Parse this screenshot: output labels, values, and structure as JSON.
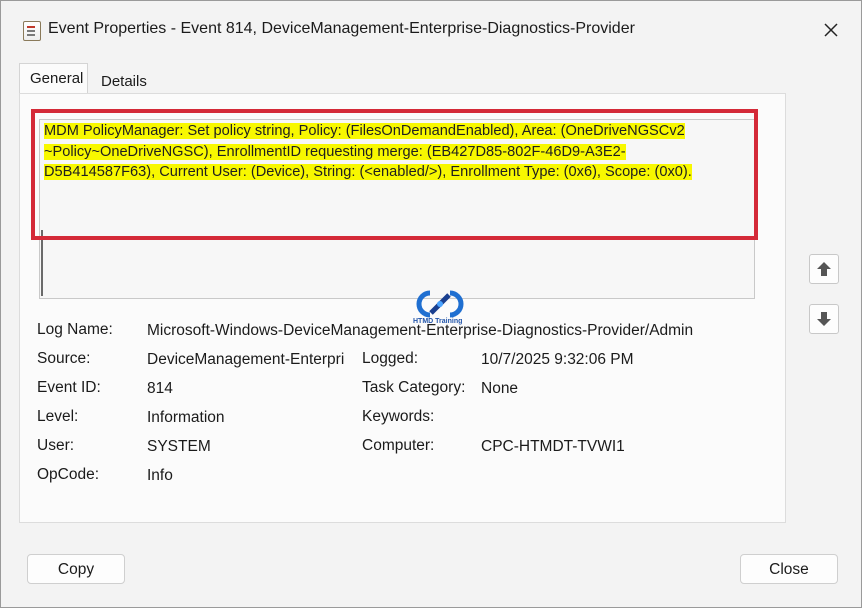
{
  "window": {
    "title": "Event Properties - Event 814, DeviceManagement-Enterprise-Diagnostics-Provider"
  },
  "tabs": [
    {
      "label": "General",
      "selected": true
    },
    {
      "label": "Details",
      "selected": false
    }
  ],
  "description": {
    "line1": "MDM PolicyManager: Set policy string, Policy: (FilesOnDemandEnabled), Area: (OneDriveNGSCv2",
    "line2": "~Policy~OneDriveNGSC), EnrollmentID requesting merge: (EB427D85-802F-46D9-A3E2-",
    "line3": "D5B414587F63), Current User: (Device), String: (<enabled/>), Enrollment Type: (0x6), Scope: (0x0)."
  },
  "watermark": {
    "text": "HTMD Training"
  },
  "fields": {
    "log_name": {
      "label": "Log Name:",
      "value": "Microsoft-Windows-DeviceManagement-Enterprise-Diagnostics-Provider/Admin"
    },
    "source": {
      "label": "Source:",
      "value": "DeviceManagement-Enterpri"
    },
    "logged": {
      "label": "Logged:",
      "value": "10/7/2025 9:32:06 PM"
    },
    "event_id": {
      "label": "Event ID:",
      "value": "814"
    },
    "task_category": {
      "label": "Task Category:",
      "value": "None"
    },
    "level": {
      "label": "Level:",
      "value": "Information"
    },
    "keywords": {
      "label": "Keywords:",
      "value": ""
    },
    "user": {
      "label": "User:",
      "value": "SYSTEM"
    },
    "computer": {
      "label": "Computer:",
      "value": "CPC-HTMDT-TVWI1"
    },
    "opcode": {
      "label": "OpCode:",
      "value": "Info"
    }
  },
  "buttons": {
    "copy": "Copy",
    "close": "Close"
  },
  "colors": {
    "highlight": "#f8f800",
    "annotation_frame": "#d42a38"
  }
}
